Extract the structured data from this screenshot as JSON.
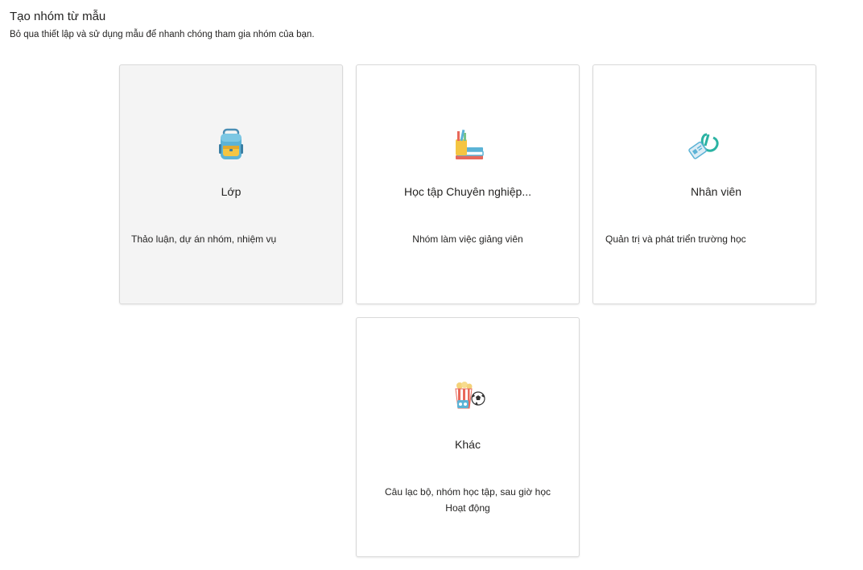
{
  "header": {
    "title": "Tạo nhóm từ mẫu",
    "subtitle": "Bỏ qua thiết lập và sử dụng mẫu để nhanh chóng tham gia nhóm của bạn."
  },
  "cards": [
    {
      "title": "Lớp",
      "description": "Thảo luận, dự án nhóm, nhiệm vụ",
      "icon": "backpack-icon"
    },
    {
      "title": "Học tập Chuyên nghiệp...",
      "description": "Nhóm làm việc giảng viên",
      "icon": "books-pencils-icon"
    },
    {
      "title": "Nhân viên",
      "description": "Quản trị và phát triển trường học",
      "icon": "badge-lanyard-icon"
    },
    {
      "title": "Khác",
      "description_line1": "Câu lạc bộ, nhóm học tập, sau giờ học",
      "description_line2": "Hoạt động",
      "icon": "popcorn-ball-icon"
    }
  ],
  "colors": {
    "hover_card_bg": "#f4f4f4",
    "card_border": "#d9d9d9",
    "text": "#252423"
  }
}
